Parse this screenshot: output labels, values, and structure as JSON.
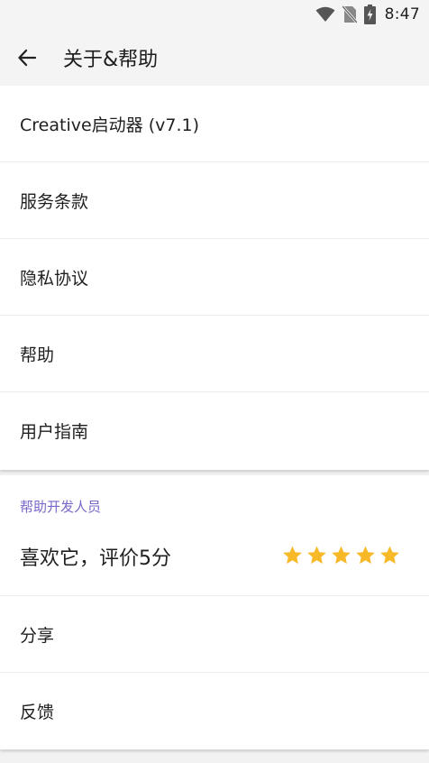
{
  "status_bar": {
    "time": "8:47"
  },
  "toolbar": {
    "title": "关于&帮助"
  },
  "about_section": {
    "items": [
      {
        "label": "Creative启动器 (v7.1)"
      },
      {
        "label": "服务条款"
      },
      {
        "label": "隐私协议"
      },
      {
        "label": "帮助"
      },
      {
        "label": "用户指南"
      }
    ]
  },
  "support_section": {
    "header": "帮助开发人员",
    "rate_label": "喜欢它，评价5分",
    "rating": 5,
    "star_color": "#f7b928",
    "items": [
      {
        "label": "分享"
      },
      {
        "label": "反馈"
      }
    ]
  }
}
